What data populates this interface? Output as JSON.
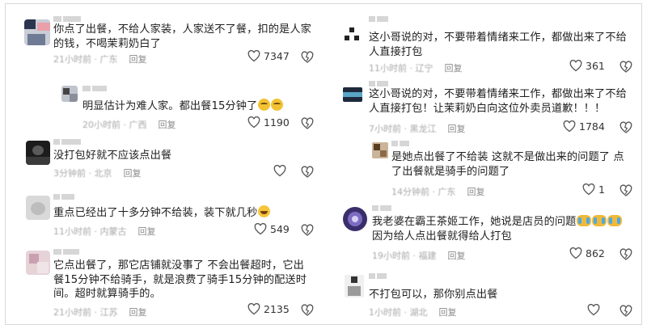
{
  "left": [
    {
      "lines": [
        "你点了出餐，不给人家装，人家送不了餐，扣的是人家",
        "的钱，不喝茉莉奶白了"
      ],
      "time": "21小时前 · 广东",
      "reply": "回复",
      "likes": "7347"
    },
    {
      "lines": [
        "明显估计为难人家。都出餐15分钟了"
      ],
      "time": "20小时前 · 广西",
      "reply": "回复",
      "likes": "1190"
    },
    {
      "lines": [
        "没打包好就不应该点出餐"
      ],
      "time": "3分钟前 · 北京",
      "reply": "回复",
      "likes": ""
    },
    {
      "lines": [
        "重点已经出了十多分钟不给装，装下就几秒"
      ],
      "time": "11小时前 · 内蒙古",
      "reply": "回复",
      "likes": "549"
    },
    {
      "lines": [
        "它点出餐了，那它店铺就没事了 不会出餐超时，它出",
        "餐15分钟不给骑手，就是浪费了骑手15分钟的配送时",
        "间。超时就算骑手的。"
      ],
      "time": "21小时前 · 江苏",
      "reply": "回复",
      "likes": "2135"
    }
  ],
  "right": [
    {
      "lines": [
        "这小哥说的对，不要带着情绪来工作，都做出来了不给",
        "人直接打包"
      ],
      "time": "11小时前 · 辽宁",
      "reply": "回复",
      "likes": "361"
    },
    {
      "lines": [
        "这小哥说的对，不要带着情绪来工作，都做出来了不给",
        "人直接打包！让茉莉奶白向这位外卖员道歉！！！"
      ],
      "time": "7小时前 · 黑龙江",
      "reply": "回复",
      "likes": "1784"
    },
    {
      "lines": [
        "是她点出餐了不给装 这就不是做出来的问题了 点",
        "了出餐就是骑手的问题了"
      ],
      "time": "14分钟前 · 广东",
      "reply": "回复",
      "likes": "1"
    },
    {
      "lines": [
        "我老婆在霸王茶姬工作，她说是店员的问题",
        "因为给人点出餐就得给人打包"
      ],
      "time": "19小时前 · 福建",
      "reply": "回复",
      "likes": "862"
    },
    {
      "lines": [
        "不打包可以，那你别点出餐"
      ],
      "time": "1小时前 · 湖北",
      "reply": "回复",
      "likes": ""
    }
  ],
  "icons": {
    "like": "heart-outline-icon",
    "dislike": "broken-heart-outline-icon"
  }
}
